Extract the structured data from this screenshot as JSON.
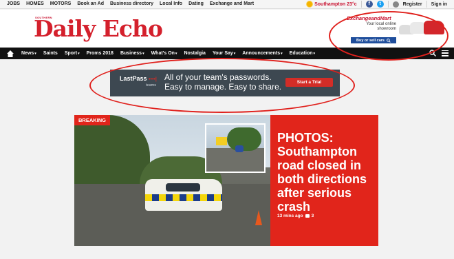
{
  "topbar": {
    "links": [
      "JOBS",
      "HOMES",
      "MOTORS",
      "Book an Ad",
      "Business directory",
      "Local Info",
      "Dating",
      "Exchange and Mart"
    ],
    "weather": "Southampton 23°c",
    "facebook_icon": "f",
    "twitter_icon": "t",
    "register": "Register",
    "signin": "Sign in"
  },
  "header": {
    "logo_small": "SOUTHERN",
    "logo": "Daily Echo",
    "ad": {
      "brand": "ExchangeandMart",
      "subtitle_1": "Your local online",
      "subtitle_2": "showroom",
      "button": "Buy or sell cars"
    }
  },
  "nav": {
    "items": [
      {
        "label": "News",
        "dropdown": true
      },
      {
        "label": "Saints",
        "dropdown": false
      },
      {
        "label": "Sport",
        "dropdown": true
      },
      {
        "label": "Proms 2018",
        "dropdown": false
      },
      {
        "label": "Business",
        "dropdown": true
      },
      {
        "label": "What's On",
        "dropdown": true
      },
      {
        "label": "Nostalgia",
        "dropdown": false
      },
      {
        "label": "Your Say",
        "dropdown": true
      },
      {
        "label": "Announcements",
        "dropdown": true
      },
      {
        "label": "Education",
        "dropdown": true
      }
    ],
    "caret": "▾"
  },
  "banner_ad": {
    "logo": "LastPass",
    "logo_dots": "••••|",
    "teams": "teams",
    "line1": "All of your team's passwords.",
    "line2": "Easy to manage. Easy to share.",
    "button": "Start a Trial"
  },
  "story": {
    "badge": "BREAKING",
    "headline": "PHOTOS: Southampton road closed in both directions after serious crash",
    "time": "13 mins ago",
    "comments": "3"
  },
  "colors": {
    "brand_red": "#d4202c",
    "nav_bg": "#111111",
    "story_red": "#e1251b",
    "annotation_red": "#e0201c"
  }
}
